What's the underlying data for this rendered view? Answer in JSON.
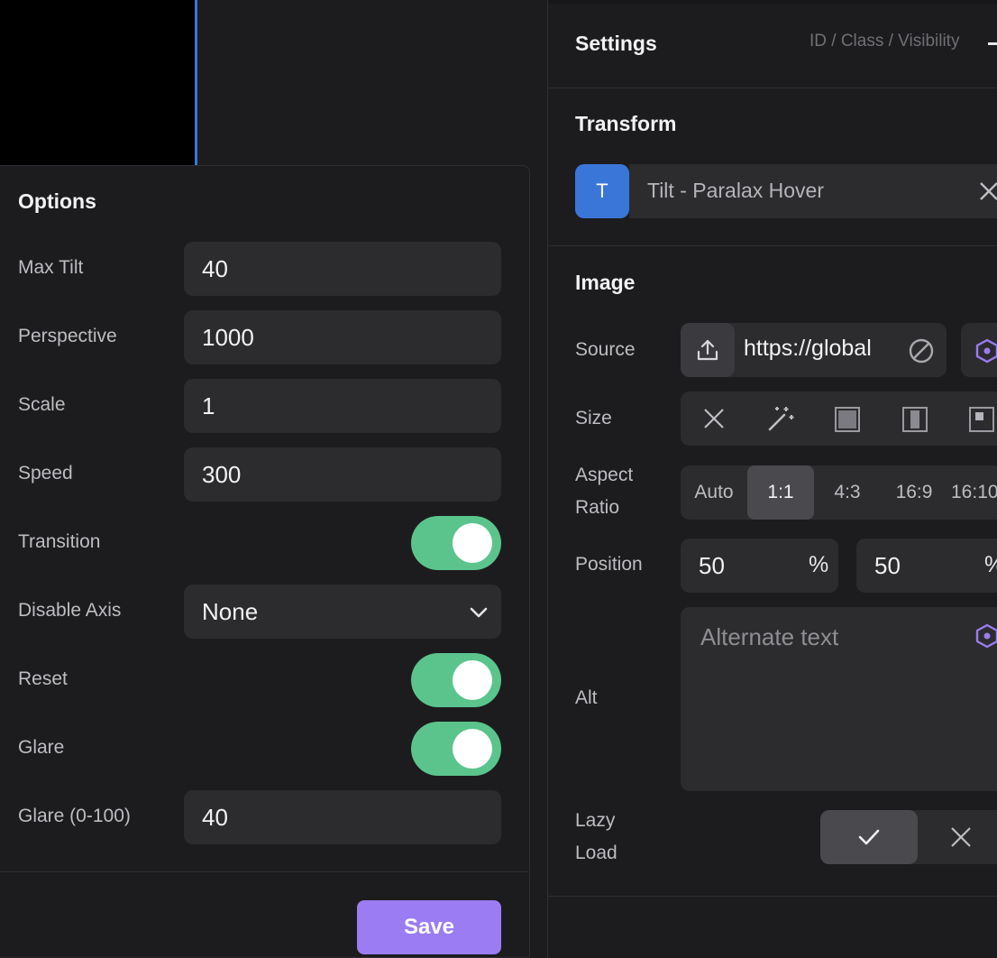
{
  "options": {
    "title": "Options",
    "fields": [
      {
        "label": "Max Tilt",
        "value": "40"
      },
      {
        "label": "Perspective",
        "value": "1000"
      },
      {
        "label": "Scale",
        "value": "1"
      },
      {
        "label": "Speed",
        "value": "300"
      }
    ],
    "transition_label": "Transition",
    "disable_axis_label": "Disable Axis",
    "disable_axis_value": "None",
    "reset_label": "Reset",
    "glare_label": "Glare",
    "glare_amount_label": "Glare (0-100)",
    "glare_amount_value": "40",
    "save_label": "Save",
    "toggle_color": "#5bc48c",
    "save_color": "#9b7cf2"
  },
  "settings": {
    "title": "Settings",
    "tabs_text": "ID / Class / Visibility",
    "transform": {
      "title": "Transform",
      "badge": "T",
      "name": "Tilt - Paralax Hover",
      "badge_color": "#3a76d8"
    },
    "image": {
      "title": "Image",
      "source_label": "Source",
      "source_value": "https://global",
      "size_label": "Size",
      "size_icons": [
        "close-icon",
        "magic-wand-icon",
        "square-fill-icon",
        "split-square-icon",
        "square-small-icon"
      ],
      "aspect_label_1": "Aspect",
      "aspect_label_2": "Ratio",
      "aspect_options": [
        "Auto",
        "1:1",
        "4:3",
        "16:9",
        "16:10"
      ],
      "aspect_selected": "1:1",
      "position_label": "Position",
      "position_x": "50",
      "position_y": "50",
      "position_unit": "%",
      "alt_label": "Alt",
      "alt_placeholder": "Alternate text",
      "lazy_label_1": "Lazy",
      "lazy_label_2": "Load"
    }
  }
}
